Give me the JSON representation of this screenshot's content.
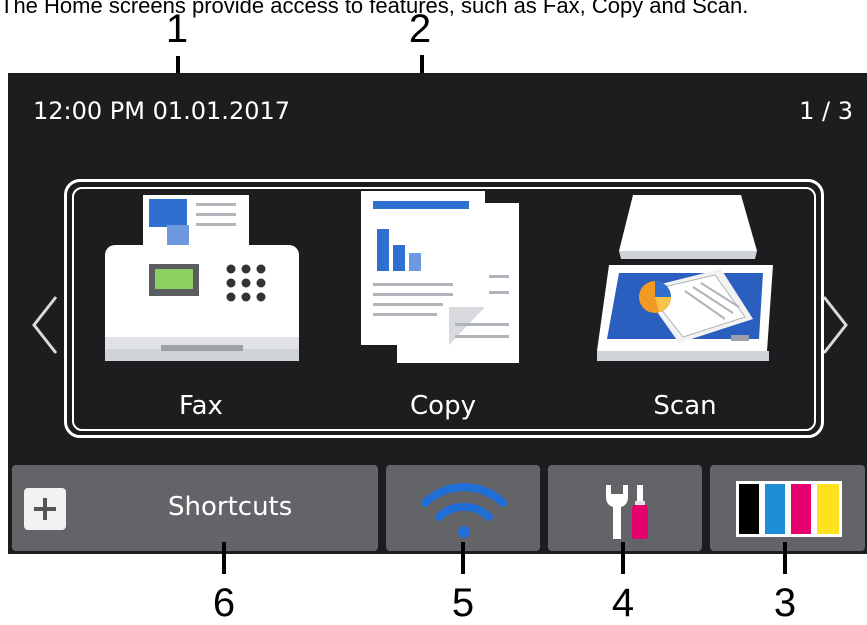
{
  "caption": "The Home screens provide access to features, such as Fax, Copy and Scan.",
  "callouts": [
    "1",
    "2",
    "3",
    "4",
    "5",
    "6"
  ],
  "status": {
    "time": "12:00  PM  01.01.2017",
    "page": "1 / 3"
  },
  "functions": [
    {
      "label": "Fax",
      "icon": "fax-machine-icon"
    },
    {
      "label": "Copy",
      "icon": "copy-documents-icon"
    },
    {
      "label": "Scan",
      "icon": "scanner-icon"
    }
  ],
  "toolbar": {
    "shortcuts_label": "Shortcuts",
    "shortcuts_icon": "plus-icon",
    "wifi_icon": "wifi-icon",
    "settings_icon": "wrench-screwdriver-icon",
    "toner_icon": "toner-cartridges-icon"
  },
  "colors": {
    "screen_bg": "#1d1d1f",
    "button_bg": "#636468",
    "wifi": "#1f6ed8",
    "toner_black": "#000000",
    "toner_cyan": "#1e8fd6",
    "toner_magenta": "#e5006e",
    "toner_yellow": "#ffe21e"
  }
}
